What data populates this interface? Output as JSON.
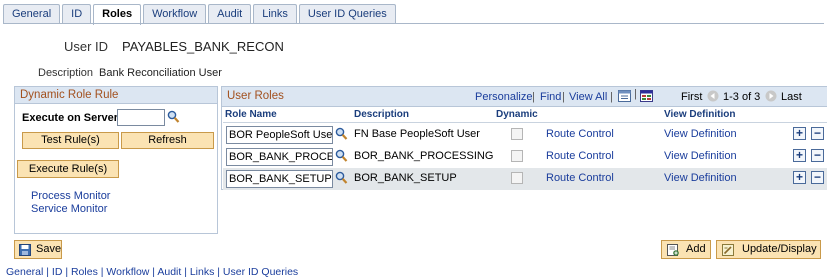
{
  "tabs": [
    {
      "label": "General"
    },
    {
      "label": "ID"
    },
    {
      "label": "Roles"
    },
    {
      "label": "Workflow"
    },
    {
      "label": "Audit"
    },
    {
      "label": "Links"
    },
    {
      "label": "User ID Queries"
    }
  ],
  "header": {
    "user_id_label": "User ID",
    "user_id_value": "PAYABLES_BANK_RECON",
    "description_label": "Description",
    "description_value": "Bank Reconciliation User"
  },
  "rule_panel": {
    "title": "Dynamic Role Rule",
    "execute_on_server_label": "Execute on Server",
    "execute_on_server_value": "",
    "test_rules_button": "Test Rule(s)",
    "refresh_button": "Refresh",
    "execute_rules_button": "Execute Rule(s)",
    "process_monitor_link": "Process Monitor",
    "service_monitor_link": "Service Monitor"
  },
  "roles_grid": {
    "title": "User Roles",
    "personalize": "Personalize",
    "find": "Find",
    "view_all": "View All",
    "first": "First",
    "range": "1-3 of 3",
    "last": "Last",
    "columns": [
      "Role Name",
      "Description",
      "Dynamic",
      "",
      "View Definition"
    ],
    "rows": [
      {
        "role_name": "BOR PeopleSoft User",
        "description": "FN Base PeopleSoft User",
        "dynamic": false,
        "route_control": "Route Control",
        "view_definition": "View Definition"
      },
      {
        "role_name": "BOR_BANK_PROCESSING",
        "description": "BOR_BANK_PROCESSING",
        "dynamic": false,
        "route_control": "Route Control",
        "view_definition": "View Definition"
      },
      {
        "role_name": "BOR_BANK_SETUP",
        "description": "BOR_BANK_SETUP",
        "dynamic": false,
        "route_control": "Route Control",
        "view_definition": "View Definition"
      }
    ]
  },
  "footer": {
    "save_button": "Save",
    "add_button": "Add",
    "update_display_button": "Update/Display",
    "bottom_links": "General | ID | Roles | Workflow | Audit | Links | User ID Queries"
  },
  "colors": {
    "panel_header_bg": "#dce6f2",
    "panel_title": "#a2501e",
    "link": "#1a3d9c",
    "button_bg": "#fbe3b3",
    "selected_row": "#e3e7ea"
  },
  "icons": [
    "search-icon",
    "grid-zoom-icon",
    "download-icon",
    "first-arrow-icon",
    "last-arrow-icon",
    "plus-icon",
    "minus-icon",
    "save-icon",
    "add-icon",
    "update-icon"
  ]
}
